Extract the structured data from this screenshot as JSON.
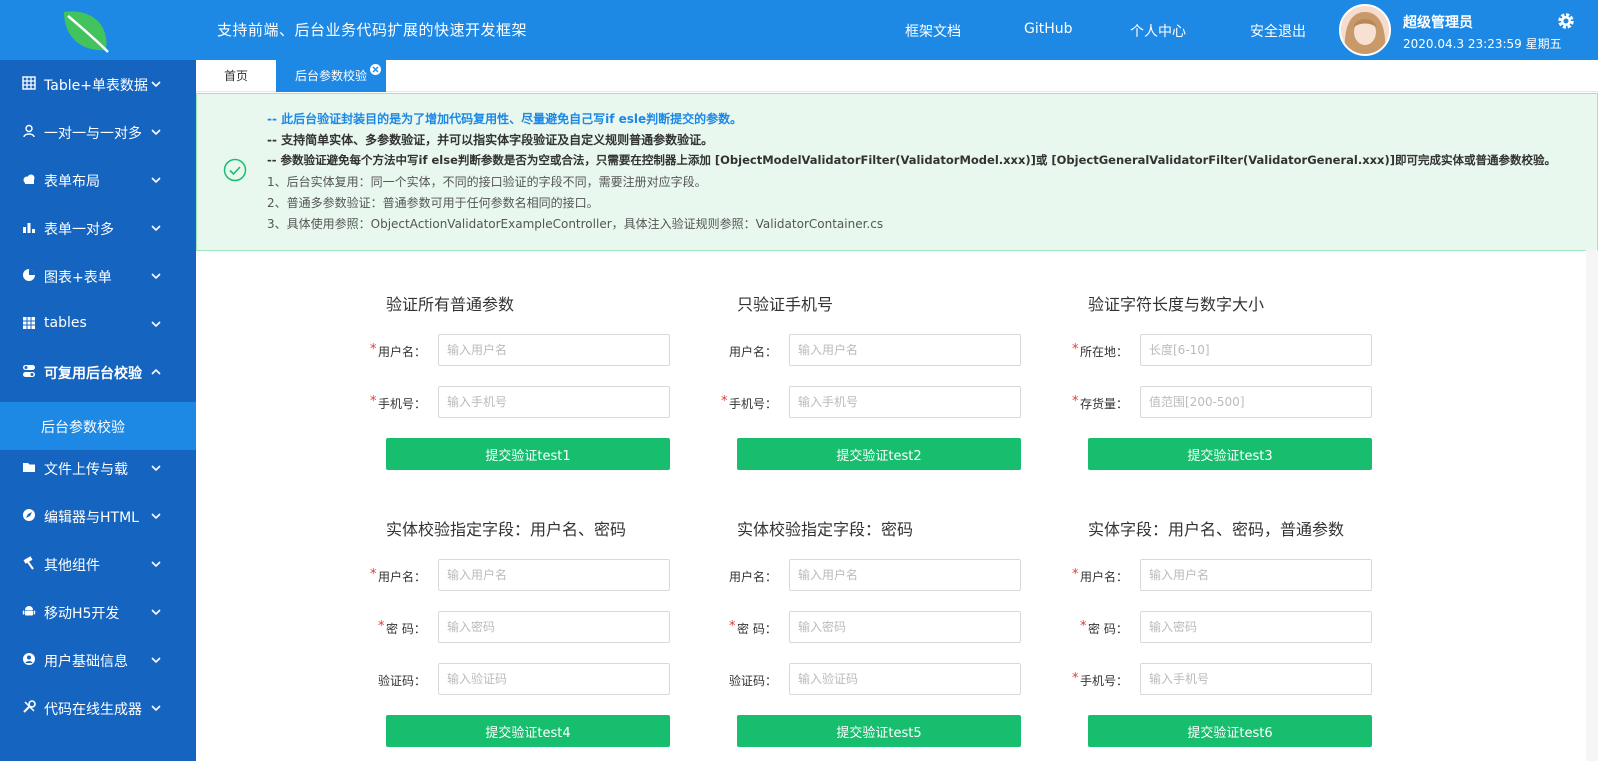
{
  "header": {
    "title": "支持前端、后台业务代码扩展的快速开发框架",
    "nav": [
      "框架文档",
      "GitHub",
      "个人中心",
      "安全退出"
    ],
    "user_name": "超级管理员",
    "datetime": "2020.04.3 23:23:59 星期五",
    "logo_icon": "leaf-logo",
    "settings_icon": "gear-icon",
    "accent": "#1e88e5"
  },
  "sidebar": {
    "bg": "#1565c0",
    "items": [
      {
        "label": "Table+单表数据",
        "icon": "table-icon"
      },
      {
        "label": "一对一与一对多",
        "icon": "user-icon"
      },
      {
        "label": "表单布局",
        "icon": "cloud-icon"
      },
      {
        "label": "表单一对多",
        "icon": "bar-chart-icon"
      },
      {
        "label": "图表+表单",
        "icon": "pie-chart-icon"
      },
      {
        "label": "tables",
        "icon": "grid-icon"
      },
      {
        "label": "可复用后台校验",
        "icon": "toggle-icon",
        "expanded": true
      },
      {
        "label": "文件上传与载",
        "icon": "folder-icon"
      },
      {
        "label": "编辑器与HTML",
        "icon": "compass-icon"
      },
      {
        "label": "其他组件",
        "icon": "hammer-icon"
      },
      {
        "label": "移动H5开发",
        "icon": "android-icon"
      },
      {
        "label": "用户基础信息",
        "icon": "user-circle-icon"
      },
      {
        "label": "代码在线生成器",
        "icon": "tools-icon"
      }
    ],
    "active_sub": "后台参数校验"
  },
  "tabs": {
    "home": "首页",
    "active": "后台参数校验"
  },
  "notice": {
    "lines": [
      "-- 此后台验证封装目的是为了增加代码复用性、尽量避免自己写if esle判断提交的参数。",
      "-- 支持简单实体、多参数验证，并可以指实体字段验证及自定义规则普通参数验证。",
      "-- 参数验证避免每个方法中写if else判断参数是否为空或合法，只需要在控制器上添加 [ObjectModelValidatorFilter(ValidatorModel.xxx)]或 [ObjectGeneralValidatorFilter(ValidatorGeneral.xxx)]即可完成实体或普通参数校验。",
      "1、后台实体复用：同一个实体，不同的接口验证的字段不同，需要注册对应字段。",
      "2、普通多参数验证：普通参数可用于任何参数名相同的接口。",
      "3、具体使用参照：ObjectActionValidatorExampleController，具体注入验证规则参照：ValidatorContainer.cs"
    ]
  },
  "forms": [
    {
      "title": "验证所有普通参数",
      "fields": [
        {
          "label": "用户名：",
          "placeholder": "输入用户名",
          "required": true
        },
        {
          "label": "手机号：",
          "placeholder": "输入手机号",
          "required": true
        }
      ],
      "button": "提交验证test1"
    },
    {
      "title": "只验证手机号",
      "fields": [
        {
          "label": "用户名：",
          "placeholder": "输入用户名",
          "required": false
        },
        {
          "label": "手机号：",
          "placeholder": "输入手机号",
          "required": true
        }
      ],
      "button": "提交验证test2"
    },
    {
      "title": "验证字符长度与数字大小",
      "fields": [
        {
          "label": "所在地：",
          "placeholder": "长度[6-10]",
          "required": true
        },
        {
          "label": "存货量：",
          "placeholder": "值范围[200-500]",
          "required": true
        }
      ],
      "button": "提交验证test3"
    },
    {
      "title": "实体校验指定字段：用户名、密码",
      "fields": [
        {
          "label": "用户名：",
          "placeholder": "输入用户名",
          "required": true
        },
        {
          "label": "密 码：",
          "placeholder": "输入密码",
          "required": true
        },
        {
          "label": "验证码：",
          "placeholder": "输入验证码",
          "required": false
        }
      ],
      "button": "提交验证test4"
    },
    {
      "title": "实体校验指定字段：密码",
      "fields": [
        {
          "label": "用户名：",
          "placeholder": "输入用户名",
          "required": false
        },
        {
          "label": "密 码：",
          "placeholder": "输入密码",
          "required": true
        },
        {
          "label": "验证码：",
          "placeholder": "输入验证码",
          "required": false
        }
      ],
      "button": "提交验证test5"
    },
    {
      "title": "实体字段：用户名、密码，普通参数",
      "fields": [
        {
          "label": "用户名：",
          "placeholder": "输入用户名",
          "required": true
        },
        {
          "label": "密 码：",
          "placeholder": "输入密码",
          "required": true
        },
        {
          "label": "手机号：",
          "placeholder": "输入手机号",
          "required": true
        }
      ],
      "button": "提交验证test6"
    }
  ],
  "button_color": "#16be6d",
  "required_mark": "*"
}
